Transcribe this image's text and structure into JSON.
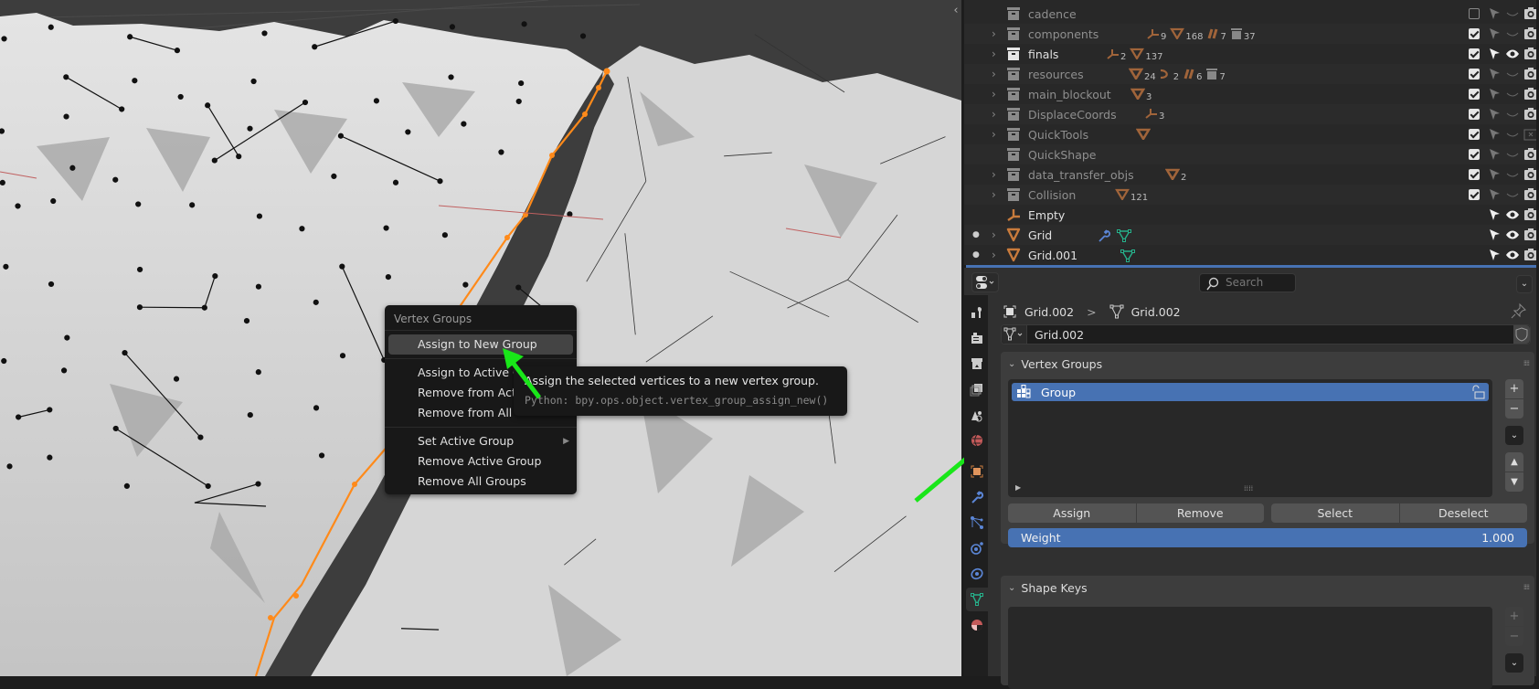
{
  "viewport": {
    "collapse_icon": "chevron-left-icon",
    "selection_color": "#ff8a1a",
    "mesh_color": "#d2d2d2"
  },
  "context_menu": {
    "title": "Vertex Groups",
    "items": [
      {
        "label": "Assign to New Group",
        "highlighted": true
      },
      {
        "label": "Assign to Active Group"
      },
      {
        "label": "Remove from Active Group"
      },
      {
        "label": "Remove from All"
      },
      {
        "label": "Set Active Group",
        "submenu": true
      },
      {
        "label": "Remove Active Group"
      },
      {
        "label": "Remove All Groups"
      }
    ]
  },
  "tooltip": {
    "description": "Assign the selected vertices to a new vertex group.",
    "python": "Python: bpy.ops.object.vertex_group_assign_new()"
  },
  "outliner": {
    "rows": [
      {
        "name": "cadence",
        "type": "collection",
        "expandable": false,
        "bright": false,
        "badges": [],
        "checkbox": false
      },
      {
        "name": "components",
        "type": "collection",
        "expandable": true,
        "bright": false,
        "badges": [
          {
            "icon": "empty-icon",
            "count": "9"
          },
          {
            "icon": "mesh-data-icon",
            "count": "168"
          },
          {
            "icon": "curve-icon",
            "count": "7"
          },
          {
            "icon": "collection-icon",
            "count": "37"
          }
        ],
        "checkbox": true
      },
      {
        "name": "finals",
        "type": "collection",
        "expandable": true,
        "bright": true,
        "badges": [
          {
            "icon": "empty-icon",
            "count": "2"
          },
          {
            "icon": "mesh-data-icon",
            "count": "137"
          }
        ],
        "checkbox": true
      },
      {
        "name": "resources",
        "type": "collection",
        "expandable": true,
        "bright": false,
        "badges": [
          {
            "icon": "mesh-icon",
            "count": "24"
          },
          {
            "icon": "light-icon",
            "count": "2"
          },
          {
            "icon": "curve-icon",
            "count": "6"
          },
          {
            "icon": "collection-icon",
            "count": "7"
          }
        ],
        "checkbox": true
      },
      {
        "name": "main_blockout",
        "type": "collection",
        "expandable": true,
        "bright": false,
        "badges": [
          {
            "icon": "mesh-icon",
            "count": "3"
          }
        ],
        "checkbox": true
      },
      {
        "name": "DisplaceCoords",
        "type": "collection",
        "expandable": true,
        "bright": false,
        "badges": [
          {
            "icon": "empty-icon",
            "count": "3"
          }
        ],
        "checkbox": true
      },
      {
        "name": "QuickTools",
        "type": "collection",
        "expandable": true,
        "bright": false,
        "badges": [
          {
            "icon": "mesh-icon",
            "count": ""
          }
        ],
        "checkbox": true,
        "render_disabled": true
      },
      {
        "name": "QuickShape",
        "type": "collection",
        "expandable": false,
        "bright": false,
        "badges": [],
        "checkbox": true
      },
      {
        "name": "data_transfer_objs",
        "type": "collection",
        "expandable": true,
        "bright": false,
        "badges": [
          {
            "icon": "mesh-icon",
            "count": "2"
          }
        ],
        "checkbox": true
      },
      {
        "name": "Collision",
        "type": "collection",
        "expandable": true,
        "bright": false,
        "badges": [
          {
            "icon": "mesh-data-icon",
            "count": "121"
          }
        ],
        "checkbox": true
      },
      {
        "name": "Empty",
        "type": "empty",
        "expandable": false,
        "bright": true,
        "badges": [],
        "visible": true
      },
      {
        "name": "Grid",
        "type": "mesh",
        "expandable": true,
        "bright": true,
        "dot": true,
        "badges": [
          {
            "icon": "wrench-icon",
            "count": ""
          },
          {
            "icon": "mesh-data-icon",
            "count": ""
          }
        ],
        "visible": true
      },
      {
        "name": "Grid.001",
        "type": "mesh",
        "expandable": true,
        "bright": true,
        "dot": true,
        "badges": [
          {
            "icon": "mesh-data-icon",
            "count": ""
          }
        ],
        "visible": true
      }
    ]
  },
  "properties": {
    "search_placeholder": "Search",
    "breadcrumb": {
      "object": "Grid.002",
      "separator": ">",
      "mesh": "Grid.002"
    },
    "datablock_name": "Grid.002",
    "tabs": [
      "tool",
      "render",
      "output",
      "view-layer",
      "scene",
      "world",
      "object",
      "modifiers",
      "particles",
      "physics",
      "constraints",
      "data",
      "material"
    ],
    "active_tab": "data",
    "vertex_groups": {
      "title": "Vertex Groups",
      "items": [
        {
          "name": "Group",
          "selected": true
        }
      ],
      "buttons": [
        "Assign",
        "Remove",
        "Select",
        "Deselect"
      ],
      "weight_label": "Weight",
      "weight_value": "1.000"
    },
    "shape_keys": {
      "title": "Shape Keys"
    }
  },
  "colors": {
    "accent": "#4772b3",
    "object_orange": "#c87b3c",
    "mesh_green": "#26b08a",
    "annotation_arrow": "#19e619"
  }
}
